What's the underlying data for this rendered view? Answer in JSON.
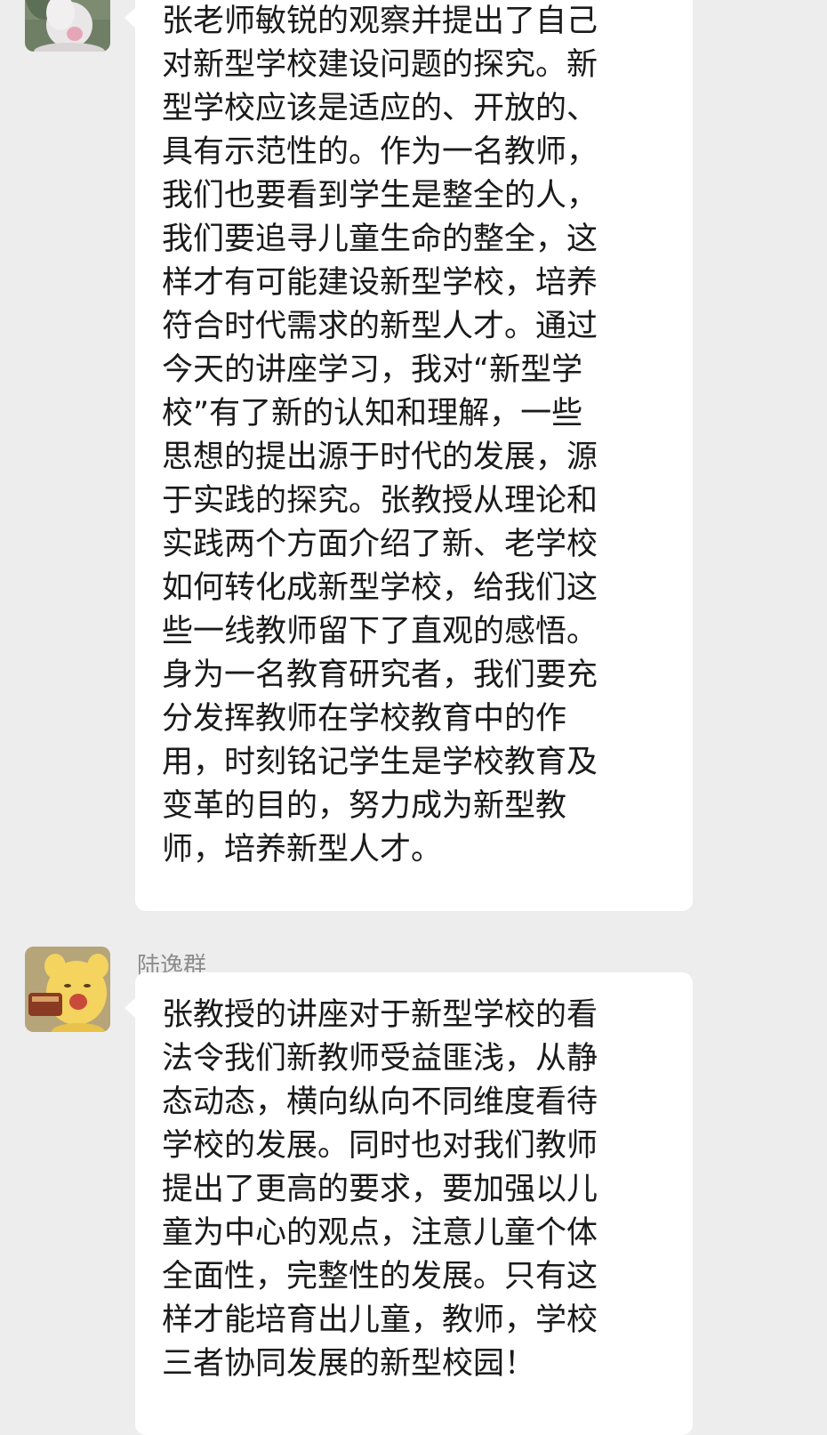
{
  "chat": {
    "messages": [
      {
        "sender": "",
        "avatar_icon": "white-stuffed-toy-avatar",
        "text": "张老师敏锐的观察并提出了自己\n对新型学校建设问题的探究。新\n型学校应该是适应的、开放的、\n具有示范性的。作为一名教师，\n我们也要看到学生是整全的人，\n我们要追寻儿童生命的整全，这\n样才有可能建设新型学校，培养\n符合时代需求的新型人才。通过\n今天的讲座学习，我对“新型学\n校”有了新的认知和理解，一些\n思想的提出源于时代的发展，源\n于实践的探究。张教授从理论和\n实践两个方面介绍了新、老学校\n如何转化成新型学校，给我们这\n些一线教师留下了直观的感悟。\n身为一名教育研究者，我们要充\n分发挥教师在学校教育中的作\n用，时刻铭记学生是学校教育及\n变革的目的，努力成为新型教\n师，培养新型人才。"
      },
      {
        "sender": "陆逸群",
        "avatar_icon": "yellow-cartoon-creature-avatar",
        "text": "张教授的讲座对于新型学校的看\n法令我们新教师受益匪浅，从静\n态动态，横向纵向不同维度看待\n学校的发展。同时也对我们教师\n提出了更高的要求，要加强以儿\n童为中心的观点，注意儿童个体\n全面性，完整性的发展。只有这\n样才能培育出儿童，教师，学校\n三者协同发展的新型校园！"
      }
    ]
  },
  "colors": {
    "background": "#ededed",
    "bubble": "#ffffff",
    "text": "#1a1a1a",
    "sender_name": "#8c8c8c"
  }
}
